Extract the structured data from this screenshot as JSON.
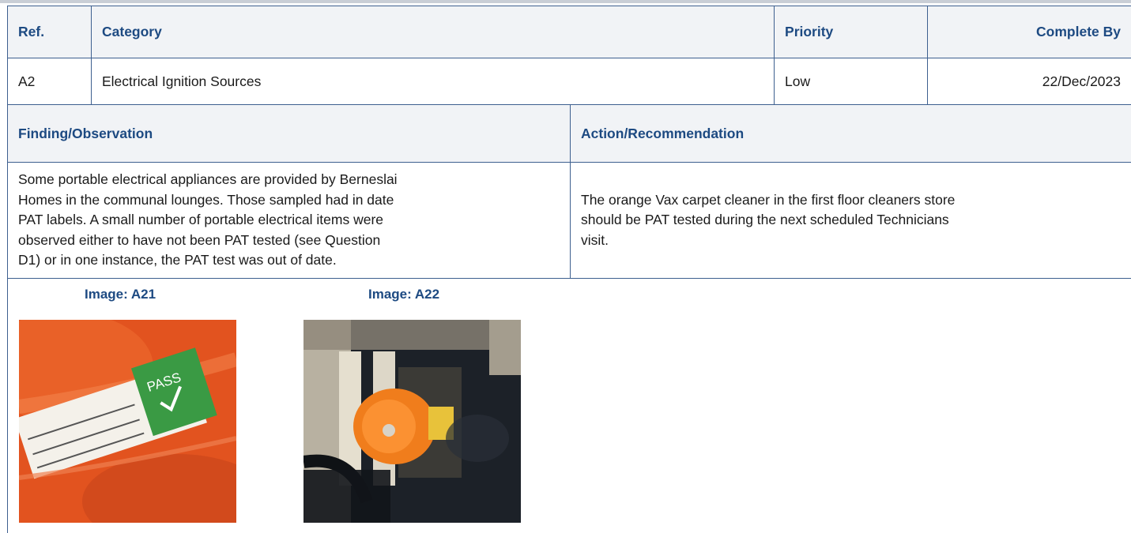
{
  "header": {
    "ref_label": "Ref.",
    "category_label": "Category",
    "priority_label": "Priority",
    "complete_by_label": "Complete By"
  },
  "item": {
    "ref": "A2",
    "category": "Electrical Ignition Sources",
    "priority": "Low",
    "complete_by": "22/Dec/2023"
  },
  "finding": {
    "label": "Finding/Observation",
    "lines": [
      "Some portable electrical appliances are provided by Berneslai",
      "Homes in the communal lounges. Those sampled had in date",
      "PAT labels. A small number of portable electrical items were",
      "observed either to have not been PAT tested (see Question",
      "D1) or in one instance, the PAT test was out of date."
    ]
  },
  "action": {
    "label": "Action/Recommendation",
    "lines": [
      "The orange Vax carpet cleaner in the first floor cleaners store",
      "should be PAT tested during the next scheduled Technicians",
      "visit."
    ]
  },
  "images": [
    {
      "caption": "Image: A21",
      "label_text": "PASS"
    },
    {
      "caption": "Image: A22"
    }
  ]
}
